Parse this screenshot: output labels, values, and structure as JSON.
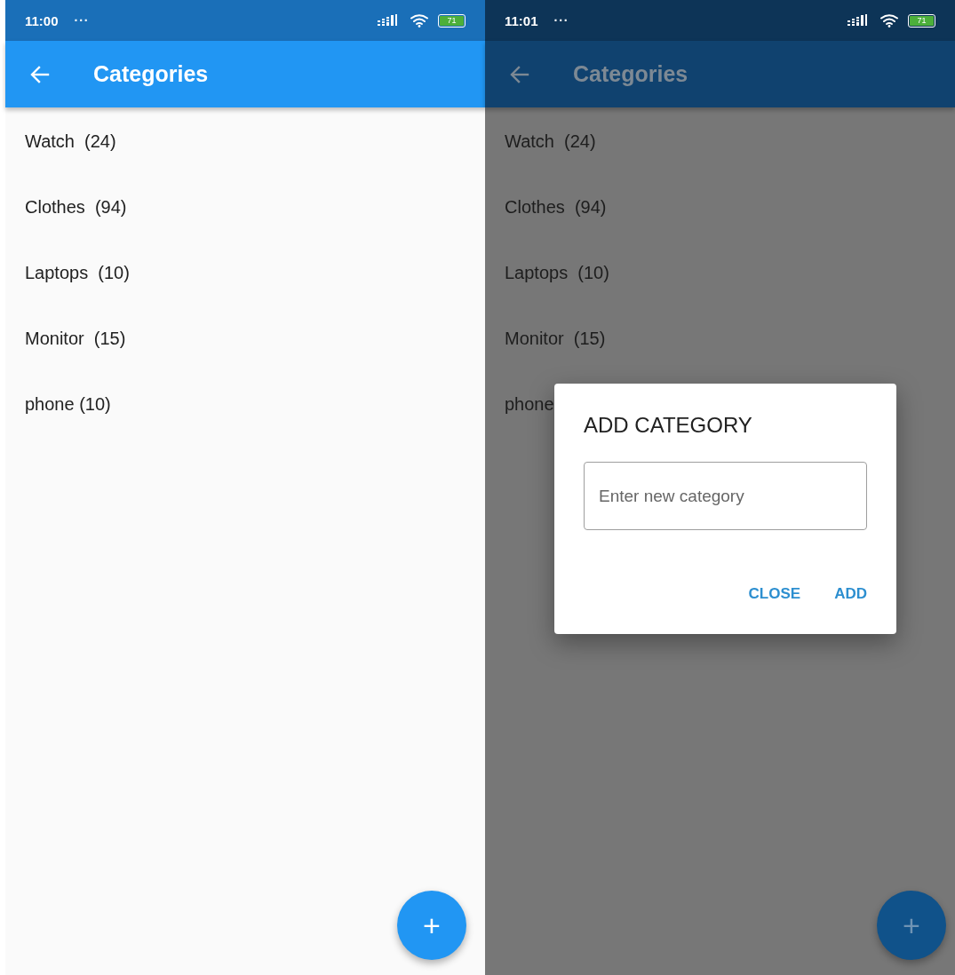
{
  "screens": [
    {
      "dimmed": false,
      "status_bar": {
        "time": "11:00",
        "more": "···",
        "battery": "71"
      },
      "app_bar": {
        "title": "Categories"
      },
      "categories": [
        "Watch  (24)",
        "Clothes  (94)",
        "Laptops  (10)",
        "Monitor  (15)",
        "phone (10)"
      ],
      "fab": {
        "label": "+"
      }
    },
    {
      "dimmed": true,
      "status_bar": {
        "time": "11:01",
        "more": "···",
        "battery": "71"
      },
      "app_bar": {
        "title": "Categories"
      },
      "categories": [
        "Watch  (24)",
        "Clothes  (94)",
        "Laptops  (10)",
        "Monitor  (15)",
        "phone"
      ],
      "fab": {
        "label": "+"
      },
      "dialog": {
        "title": "ADD CATEGORY",
        "field": {
          "placeholder": "Enter new category"
        },
        "buttons": [
          "CLOSE",
          "ADD"
        ]
      }
    }
  ]
}
